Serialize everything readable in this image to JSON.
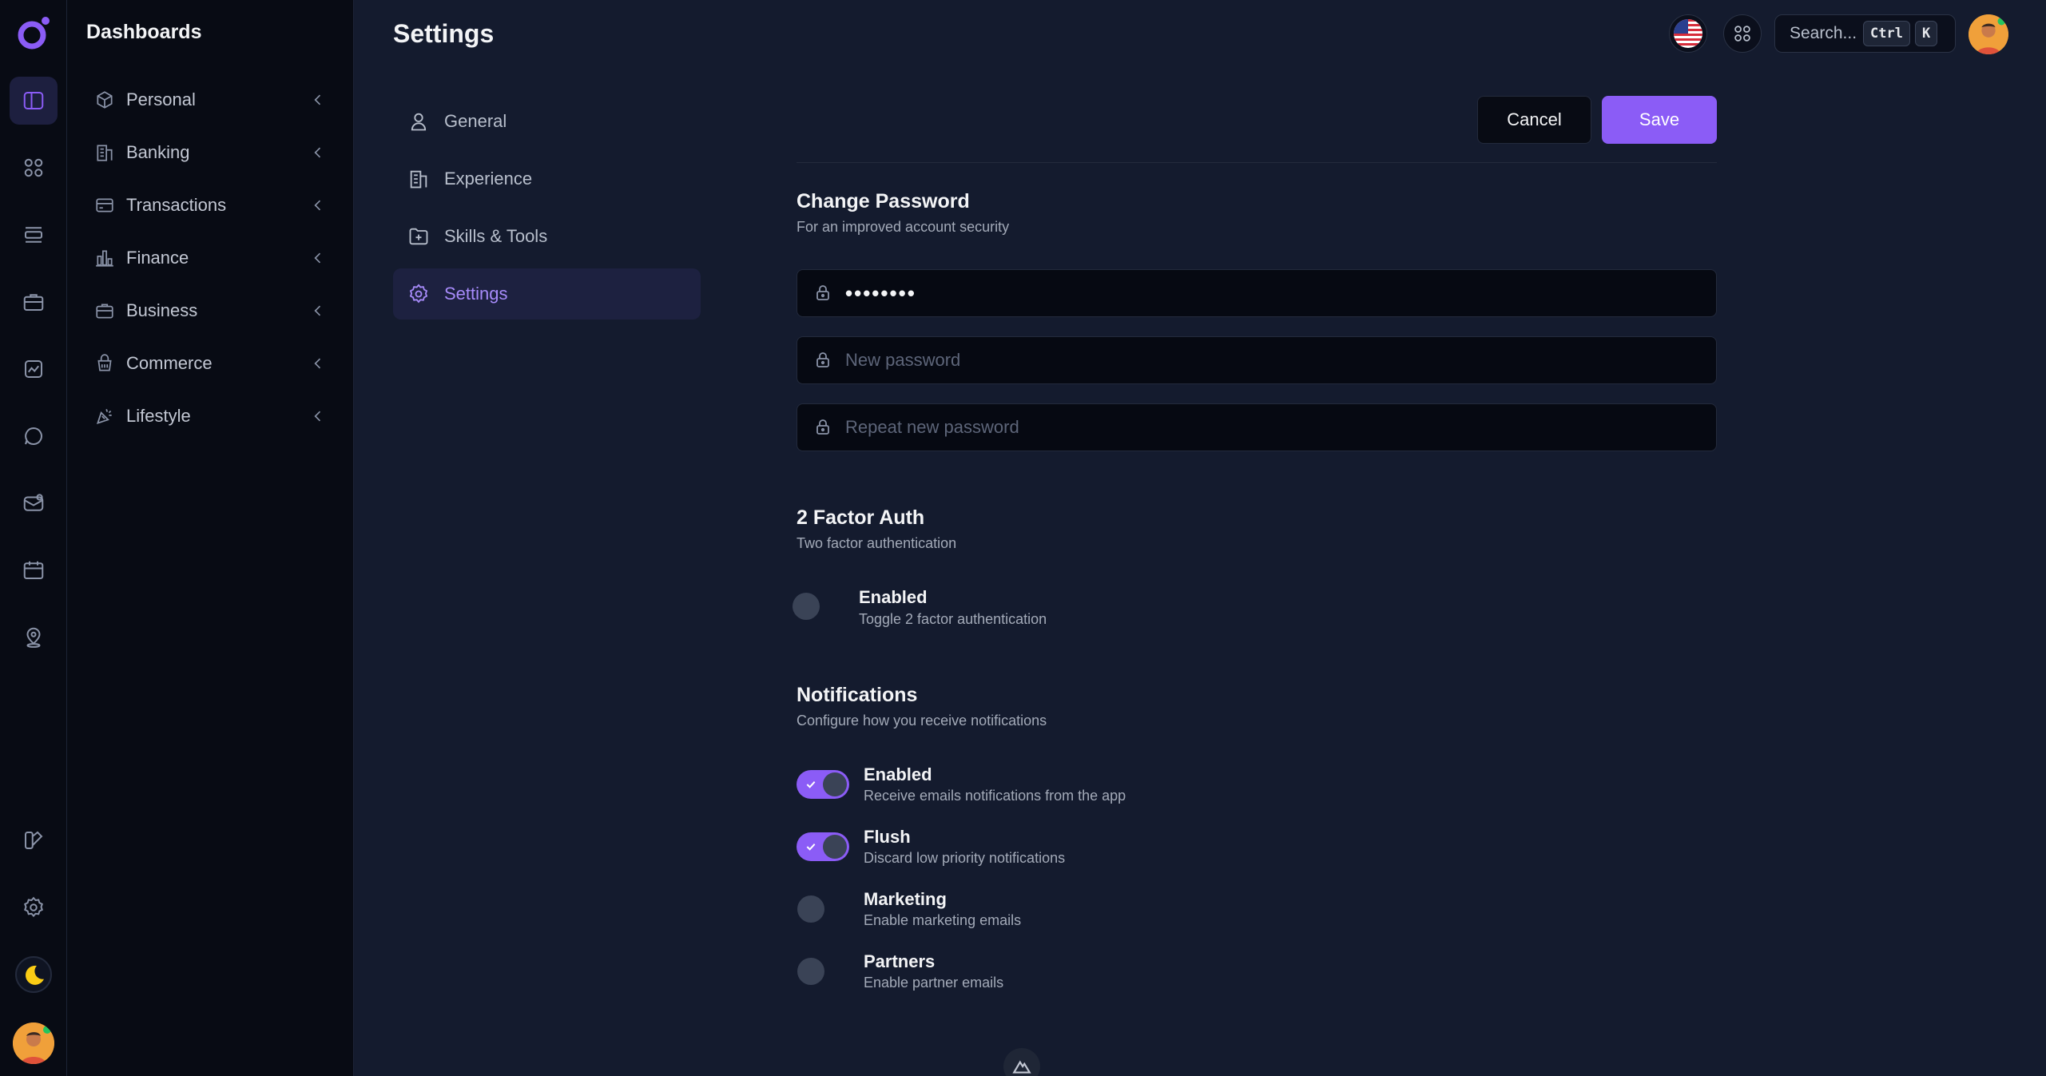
{
  "sidebar": {
    "title": "Dashboards",
    "items": [
      {
        "label": "Personal",
        "icon": "cube-icon"
      },
      {
        "label": "Banking",
        "icon": "building-icon"
      },
      {
        "label": "Transactions",
        "icon": "credit-card-icon"
      },
      {
        "label": "Finance",
        "icon": "chart-bars-icon"
      },
      {
        "label": "Business",
        "icon": "briefcase-icon"
      },
      {
        "label": "Commerce",
        "icon": "basket-icon"
      },
      {
        "label": "Lifestyle",
        "icon": "confetti-icon"
      }
    ]
  },
  "rail": {
    "icons": [
      "sidebar-layout-icon",
      "grid-icon",
      "list-icon",
      "briefcase-icon",
      "chart-icon",
      "chat-icon",
      "mail-icon",
      "calendar-icon",
      "map-pin-icon",
      "brush-icon",
      "gear-icon",
      "moon-icon"
    ],
    "accent": "#8b5cf6"
  },
  "header": {
    "title": "Settings",
    "search_placeholder": "Search...",
    "kbd_ctrl": "Ctrl",
    "kbd_k": "K"
  },
  "subnav": {
    "items": [
      {
        "label": "General"
      },
      {
        "label": "Experience"
      },
      {
        "label": "Skills & Tools"
      },
      {
        "label": "Settings"
      }
    ],
    "active": "Settings"
  },
  "actions": {
    "cancel": "Cancel",
    "save": "Save"
  },
  "password": {
    "title": "Change Password",
    "subtitle": "For an improved account security",
    "current_value": "••••••••",
    "new_placeholder": "New password",
    "repeat_placeholder": "Repeat new password"
  },
  "two_factor": {
    "title": "2 Factor Auth",
    "subtitle": "Two factor authentication",
    "option_label": "Enabled",
    "option_desc": "Toggle 2 factor authentication",
    "enabled": false
  },
  "notifications": {
    "title": "Notifications",
    "subtitle": "Configure how you receive notifications",
    "options": [
      {
        "label": "Enabled",
        "desc": "Receive emails notifications from the app",
        "on": true
      },
      {
        "label": "Flush",
        "desc": "Discard low priority notifications",
        "on": true
      },
      {
        "label": "Marketing",
        "desc": "Enable marketing emails",
        "on": false
      },
      {
        "label": "Partners",
        "desc": "Enable partner emails",
        "on": false
      }
    ]
  }
}
